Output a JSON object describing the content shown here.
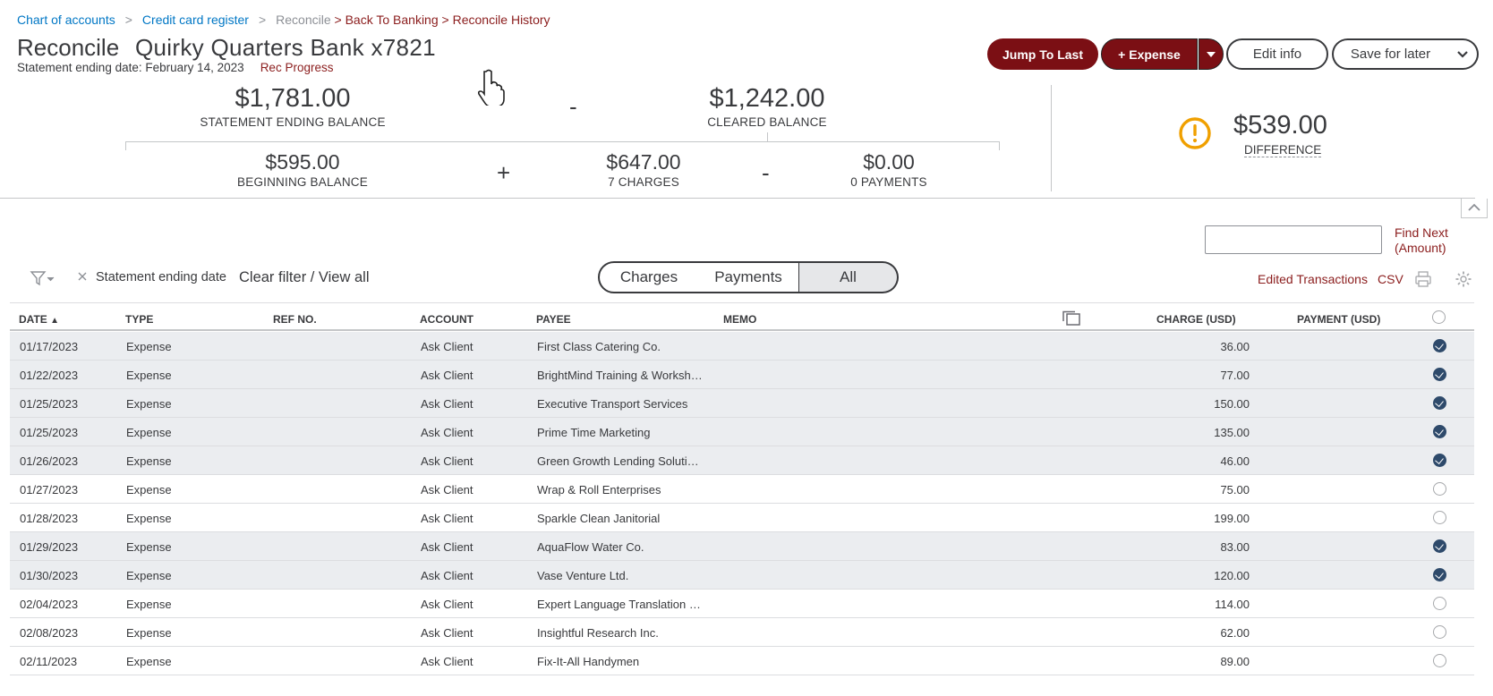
{
  "breadcrumb": {
    "chart_of_accounts": "Chart of accounts",
    "sep": ">",
    "credit_card_register": "Credit card register",
    "reconcile": "Reconcile",
    "back_to_banking": "> Back To Banking",
    "reconcile_history": "> Reconcile History"
  },
  "header": {
    "title": "Reconcile",
    "account": "Quirky Quarters Bank x7821",
    "statement_date": "Statement ending date: February 14, 2023",
    "rec_progress": "Rec Progress"
  },
  "toolbar": {
    "jump_to_last": "Jump To Last",
    "expense": "+ Expense",
    "edit_info": "Edit info",
    "save_for_later": "Save for later"
  },
  "summary": {
    "statement_ending_balance": {
      "amount": "$1,781.00",
      "label": "STATEMENT ENDING BALANCE"
    },
    "cleared_balance": {
      "amount": "$1,242.00",
      "label": "CLEARED BALANCE"
    },
    "beginning_balance": {
      "amount": "$595.00",
      "label": "BEGINNING BALANCE"
    },
    "charges": {
      "amount": "$647.00",
      "label": "7 CHARGES"
    },
    "payments": {
      "amount": "$0.00",
      "label": "0 PAYMENTS"
    },
    "difference": {
      "amount": "$539.00",
      "label": "DIFFERENCE"
    },
    "minus": "-",
    "plus": "+"
  },
  "find": {
    "placeholder": "",
    "label": "Find Next (Amount)"
  },
  "filters": {
    "active_filter": "Statement ending date",
    "clear": "Clear filter / View all",
    "tabs": [
      "Charges",
      "Payments",
      "All"
    ],
    "selected_tab": "All",
    "edited_transactions": "Edited Transactions",
    "csv": "CSV"
  },
  "table": {
    "headers": {
      "date": "DATE",
      "type": "TYPE",
      "ref": "REF NO.",
      "account": "ACCOUNT",
      "payee": "PAYEE",
      "memo": "MEMO",
      "charge": "CHARGE (USD)",
      "payment": "PAYMENT (USD)"
    },
    "rows": [
      {
        "date": "01/17/2023",
        "type": "Expense",
        "account": "Ask Client",
        "payee": "First Class Catering Co.",
        "charge": "36.00",
        "cleared": true
      },
      {
        "date": "01/22/2023",
        "type": "Expense",
        "account": "Ask Client",
        "payee": "BrightMind Training & Worksh…",
        "charge": "77.00",
        "cleared": true
      },
      {
        "date": "01/25/2023",
        "type": "Expense",
        "account": "Ask Client",
        "payee": "Executive Transport Services",
        "charge": "150.00",
        "cleared": true
      },
      {
        "date": "01/25/2023",
        "type": "Expense",
        "account": "Ask Client",
        "payee": "Prime Time Marketing",
        "charge": "135.00",
        "cleared": true
      },
      {
        "date": "01/26/2023",
        "type": "Expense",
        "account": "Ask Client",
        "payee": "Green Growth Lending Soluti…",
        "charge": "46.00",
        "cleared": true
      },
      {
        "date": "01/27/2023",
        "type": "Expense",
        "account": "Ask Client",
        "payee": "Wrap & Roll Enterprises",
        "charge": "75.00",
        "cleared": false
      },
      {
        "date": "01/28/2023",
        "type": "Expense",
        "account": "Ask Client",
        "payee": "Sparkle Clean Janitorial",
        "charge": "199.00",
        "cleared": false
      },
      {
        "date": "01/29/2023",
        "type": "Expense",
        "account": "Ask Client",
        "payee": "AquaFlow Water Co.",
        "charge": "83.00",
        "cleared": true
      },
      {
        "date": "01/30/2023",
        "type": "Expense",
        "account": "Ask Client",
        "payee": "Vase Venture Ltd.",
        "charge": "120.00",
        "cleared": true
      },
      {
        "date": "02/04/2023",
        "type": "Expense",
        "account": "Ask Client",
        "payee": "Expert Language Translation …",
        "charge": "114.00",
        "cleared": false
      },
      {
        "date": "02/08/2023",
        "type": "Expense",
        "account": "Ask Client",
        "payee": "Insightful Research Inc.",
        "charge": "62.00",
        "cleared": false
      },
      {
        "date": "02/11/2023",
        "type": "Expense",
        "account": "Ask Client",
        "payee": "Fix-It-All Handymen",
        "charge": "89.00",
        "cleared": false
      }
    ]
  },
  "colors": {
    "brand_dark_red": "#7b0f14",
    "link_blue": "#0077c5",
    "warning": "#f0a000",
    "checked": "#2e4a6b"
  }
}
